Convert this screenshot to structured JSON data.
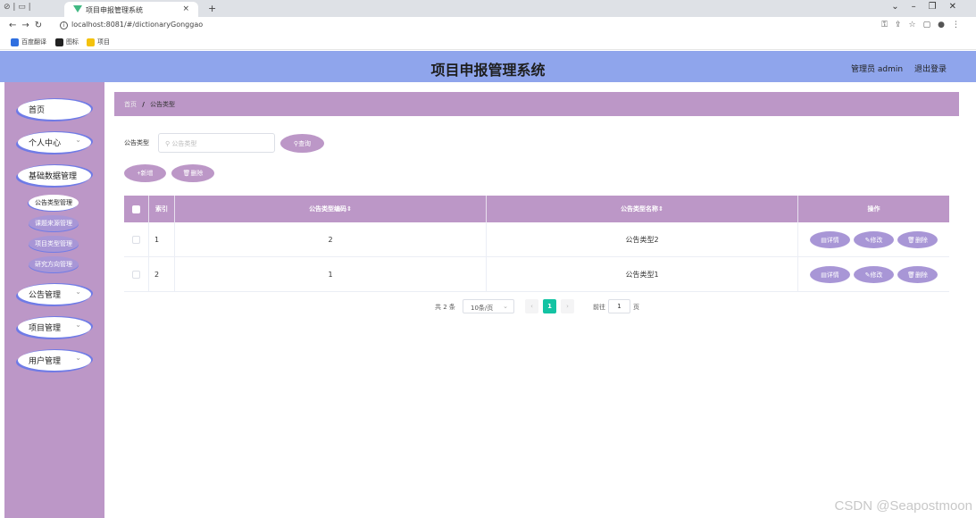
{
  "browser": {
    "tab_title": "项目申报管理系统",
    "tab_close": "×",
    "new_tab": "+",
    "url": "localhost:8081/#/dictionaryGonggao",
    "bookmarks": [
      {
        "label": "百度翻译",
        "color": "#2f6fe0"
      },
      {
        "label": "图标",
        "color": "#222"
      },
      {
        "label": "项目",
        "color": "#f4c20d"
      }
    ]
  },
  "header": {
    "title": "项目申报管理系统",
    "admin_label": "管理员 admin",
    "logout_label": "退出登录"
  },
  "sidebar": {
    "items": [
      {
        "label": "首页",
        "has_chevron": false
      },
      {
        "label": "个人中心",
        "has_chevron": true
      },
      {
        "label": "基础数据管理",
        "has_chevron": false
      }
    ],
    "sub_items": [
      {
        "label": "公告类型管理",
        "active": true
      },
      {
        "label": "课题来源管理",
        "active": false
      },
      {
        "label": "项目类型管理",
        "active": false
      },
      {
        "label": "研究方向管理",
        "active": false
      }
    ],
    "bottom_items": [
      {
        "label": "公告管理",
        "has_chevron": true
      },
      {
        "label": "项目管理",
        "has_chevron": true
      },
      {
        "label": "用户管理",
        "has_chevron": true
      }
    ],
    "chevron": "⌄"
  },
  "breadcrumb": {
    "home": "首页",
    "separator": "/",
    "current": "公告类型"
  },
  "search": {
    "label": "公告类型",
    "placeholder": "公告类型",
    "button_label": "查询"
  },
  "actions": {
    "add_label": "新增",
    "delete_label": "删除"
  },
  "table": {
    "columns": {
      "index": "索引",
      "code": "公告类型编码",
      "name": "公告类型名称",
      "ops": "操作"
    },
    "rows": [
      {
        "index": "1",
        "code": "2",
        "name": "公告类型2"
      },
      {
        "index": "2",
        "code": "1",
        "name": "公告类型1"
      }
    ],
    "op_labels": {
      "detail": "详情",
      "edit": "修改",
      "delete": "删除"
    }
  },
  "pagination": {
    "total_text": "共 2 条",
    "page_size": "10条/页",
    "current_page": "1",
    "goto_label": "前往",
    "goto_value": "1",
    "page_unit": "页"
  },
  "watermark": "CSDN @Seapostmoon",
  "colors": {
    "header": "#8fa5ec",
    "sidebar": "#bc97c7",
    "table_header": "#bc97c7",
    "op_button": "#a896d6",
    "pager_active": "#13c3a3"
  }
}
